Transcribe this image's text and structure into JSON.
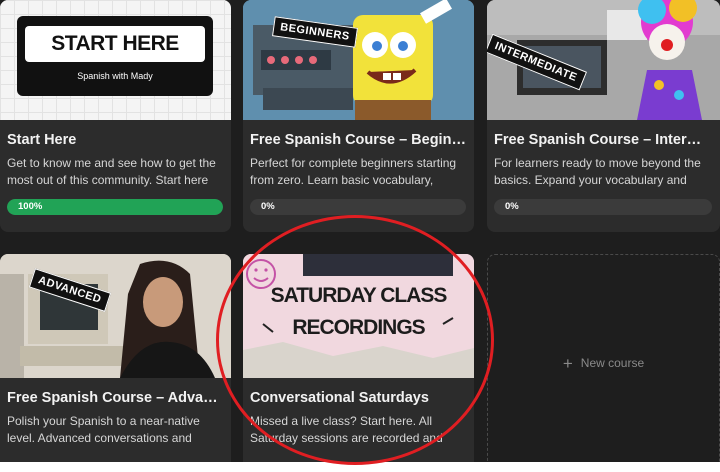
{
  "courses": [
    {
      "title": "Start Here",
      "description": "Get to know me and see how to get the most out of this community. Start here before...",
      "progress": "100%",
      "progress_value": 1.0,
      "thumb_heading": "START HERE",
      "thumb_sub": "Spanish with Mady"
    },
    {
      "title": "Free Spanish Course – Beginners",
      "description": "Perfect for complete beginners starting from zero. Learn basic vocabulary, pronunciation,...",
      "progress": "0%",
      "progress_value": 0,
      "tag": "BEGINNERS"
    },
    {
      "title": "Free Spanish Course – Intermedia...",
      "description": "For learners ready to move beyond the basics. Expand your vocabulary and start...",
      "progress": "0%",
      "progress_value": 0,
      "tag": "INTERMEDIATE"
    },
    {
      "title": "Free Spanish Course – Advanced",
      "description": "Polish your Spanish to a near-native level. Advanced conversations and cultural depth.",
      "tag": "ADVANCED"
    },
    {
      "title": "Conversational Saturdays",
      "description": "Missed a live class? Start here. All Saturday sessions are recorded and uploaded for you...",
      "thumb_line1": "SATURDAY CLASS",
      "thumb_line2": "RECORDINGS"
    }
  ],
  "new_course_label": "New course",
  "colors": {
    "progress_complete": "#21a356",
    "annotation_circle": "#e01e22",
    "card_bg": "#2c2c2c",
    "page_bg": "#1e1e1e"
  }
}
